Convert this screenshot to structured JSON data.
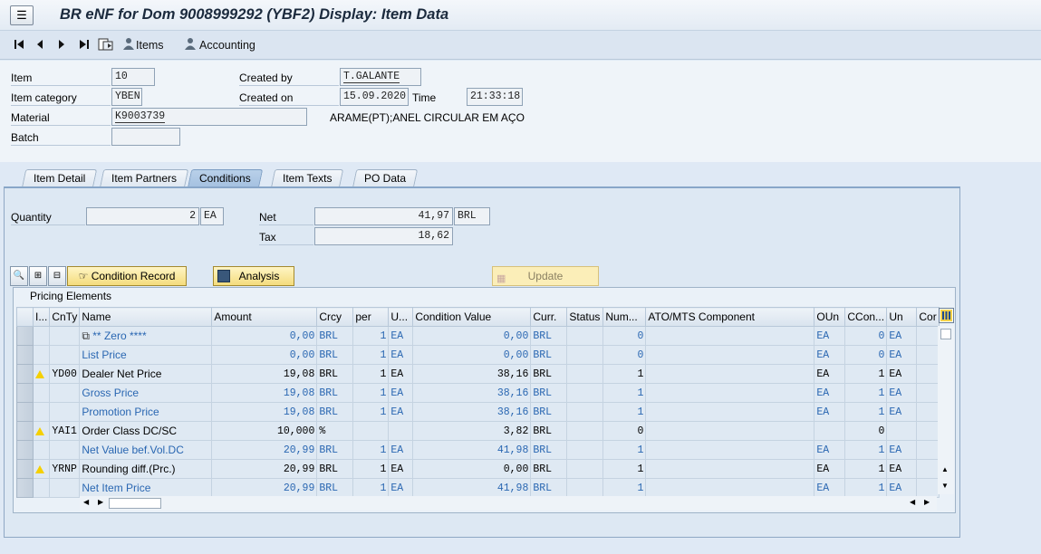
{
  "window": {
    "title": "BR eNF for Dom 9008999292 (YBF2) Display: Item Data"
  },
  "toolbar": {
    "items_label": "Items",
    "accounting_label": "Accounting"
  },
  "header": {
    "item_label": "Item",
    "item_value": "10",
    "item_category_label": "Item category",
    "item_category_value": "YBEN",
    "material_label": "Material",
    "material_value": "K9003739",
    "material_description": "ARAME(PT);ANEL CIRCULAR EM AÇO",
    "batch_label": "Batch",
    "batch_value": "",
    "created_by_label": "Created by",
    "created_by_value": "T.GALANTE",
    "created_on_label": "Created on",
    "created_on_value": "15.09.2020",
    "time_label": "Time",
    "time_value": "21:33:18"
  },
  "tabs": [
    {
      "label": "Item Detail"
    },
    {
      "label": "Item Partners"
    },
    {
      "label": "Conditions"
    },
    {
      "label": "Item Texts"
    },
    {
      "label": "PO Data"
    }
  ],
  "active_tab": "Conditions",
  "conditions": {
    "quantity_label": "Quantity",
    "quantity_value": "2",
    "quantity_unit": "EA",
    "net_label": "Net",
    "net_value": "41,97",
    "net_currency": "BRL",
    "tax_label": "Tax",
    "tax_value": "18,62",
    "condition_record_label": "Condition Record",
    "analysis_label": "Analysis",
    "update_label": "Update",
    "pricing_title": "Pricing Elements"
  },
  "grid": {
    "columns": [
      "I...",
      "CnTy",
      "Name",
      "Amount",
      "Crcy",
      "per",
      "U...",
      "Condition Value",
      "Curr.",
      "Status",
      "Num...",
      "ATO/MTS Component",
      "OUn",
      "CCon...",
      "Un",
      "Cor"
    ],
    "rows": [
      {
        "warn": false,
        "cnty": "",
        "name": "** Zero ****",
        "amount": "0,00",
        "crcy": "BRL",
        "per": "1",
        "u": "EA",
        "value": "0,00",
        "curr": "BRL",
        "status": "",
        "num": "0",
        "ato": "",
        "oun": "EA",
        "ccon": "0",
        "un": "EA",
        "blue": true,
        "first": true
      },
      {
        "warn": false,
        "cnty": "",
        "name": "List Price",
        "amount": "0,00",
        "crcy": "BRL",
        "per": "1",
        "u": "EA",
        "value": "0,00",
        "curr": "BRL",
        "status": "",
        "num": "0",
        "ato": "",
        "oun": "EA",
        "ccon": "0",
        "un": "EA",
        "blue": true
      },
      {
        "warn": true,
        "cnty": "YD00",
        "name": "Dealer Net Price",
        "amount": "19,08",
        "crcy": "BRL",
        "per": "1",
        "u": "EA",
        "value": "38,16",
        "curr": "BRL",
        "status": "",
        "num": "1",
        "ato": "",
        "oun": "EA",
        "ccon": "1",
        "un": "EA",
        "blue": false
      },
      {
        "warn": false,
        "cnty": "",
        "name": "Gross Price",
        "amount": "19,08",
        "crcy": "BRL",
        "per": "1",
        "u": "EA",
        "value": "38,16",
        "curr": "BRL",
        "status": "",
        "num": "1",
        "ato": "",
        "oun": "EA",
        "ccon": "1",
        "un": "EA",
        "blue": true
      },
      {
        "warn": false,
        "cnty": "",
        "name": "Promotion Price",
        "amount": "19,08",
        "crcy": "BRL",
        "per": "1",
        "u": "EA",
        "value": "38,16",
        "curr": "BRL",
        "status": "",
        "num": "1",
        "ato": "",
        "oun": "EA",
        "ccon": "1",
        "un": "EA",
        "blue": true
      },
      {
        "warn": true,
        "cnty": "YAI1",
        "name": "Order Class DC/SC",
        "amount": "10,000",
        "crcy": "%",
        "per": "",
        "u": "",
        "value": "3,82",
        "curr": "BRL",
        "status": "",
        "num": "0",
        "ato": "",
        "oun": "",
        "ccon": "0",
        "un": "",
        "blue": false
      },
      {
        "warn": false,
        "cnty": "",
        "name": "Net Value bef.Vol.DC",
        "amount": "20,99",
        "crcy": "BRL",
        "per": "1",
        "u": "EA",
        "value": "41,98",
        "curr": "BRL",
        "status": "",
        "num": "1",
        "ato": "",
        "oun": "EA",
        "ccon": "1",
        "un": "EA",
        "blue": true
      },
      {
        "warn": true,
        "cnty": "YRNP",
        "name": "Rounding diff.(Prc.)",
        "amount": "20,99",
        "crcy": "BRL",
        "per": "1",
        "u": "EA",
        "value": "0,00",
        "curr": "BRL",
        "status": "",
        "num": "1",
        "ato": "",
        "oun": "EA",
        "ccon": "1",
        "un": "EA",
        "blue": false
      },
      {
        "warn": false,
        "cnty": "",
        "name": "Net Item Price",
        "amount": "20,99",
        "crcy": "BRL",
        "per": "1",
        "u": "EA",
        "value": "41,98",
        "curr": "BRL",
        "status": "",
        "num": "1",
        "ato": "",
        "oun": "EA",
        "ccon": "1",
        "un": "EA",
        "blue": true
      }
    ]
  },
  "colors": {
    "link_blue": "#2a67b2",
    "warning_yellow": "#f5d000",
    "button_yellow": "#f4dc7d"
  }
}
